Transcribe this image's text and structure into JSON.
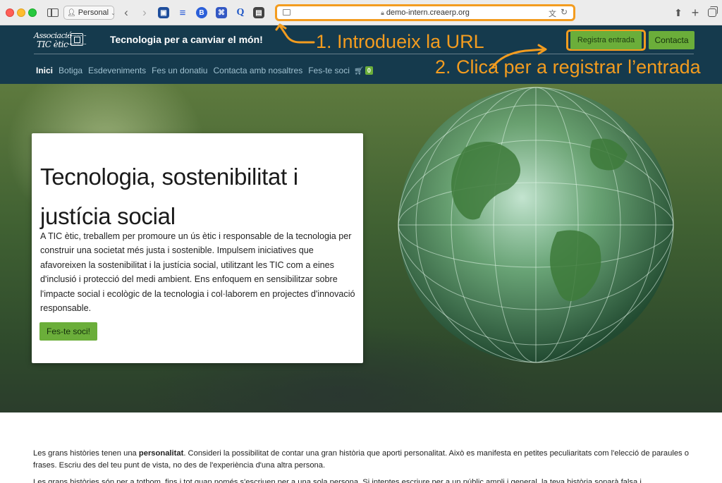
{
  "browser": {
    "profile_label": "Personal",
    "url": "demo-intern.creaerp.org",
    "extensions": [
      "bitwarden-icon",
      "layers-icon",
      "b-circle-icon",
      "translate-box-icon",
      "q-icon",
      "capture-icon"
    ]
  },
  "header": {
    "logo_line1": "Associació",
    "logo_line2": "TIC ètic",
    "tagline": "Tecnologia per a canviar el món!",
    "registra_label": "Registra entrada",
    "contacta_label": "Contacta",
    "accent_color": "#6bae3a",
    "bg_color": "#153a4d"
  },
  "nav": {
    "items": [
      "Inici",
      "Botiga",
      "Esdeveniments",
      "Fes un donatiu",
      "Contacta amb nosaltres",
      "Fes-te soci"
    ],
    "cart_count": "0"
  },
  "annotations": {
    "step1": "1. Introdueix la URL",
    "step2": "2. Clica per a registrar l’entrada",
    "color": "#f39c1f"
  },
  "hero": {
    "title": "Tecnologia, sostenibilitat i justícia social",
    "text": "A TIC ètic, treballem per promoure un ús ètic i responsable de la tecnologia per construir una societat més justa i sostenible. Impulsem iniciatives que afavoreixen la sostenibilitat i la justícia social, utilitzant les TIC com a eines d'inclusió i protecció del medi ambient. Ens enfoquem en sensibilitzar sobre l'impacte social i ecològic de la tecnologia i col·laborem en projectes d'innovació responsable.",
    "button_label": "Fes-te soci!"
  },
  "body": {
    "para1_before": "Les grans històries tenen una ",
    "para1_bold": "personalitat",
    "para1_after": ". Consideri la possibilitat de contar una gran història que aporti personalitat. Això es manifesta en petites peculiaritats com l'elecció de paraules o frases. Escriu des del teu punt de vista, no des de l'experiència d'una altra persona.",
    "para2": "Les grans històries són per a tothom, fins i tot quan només s'escriuen per a una sola persona. Si intentes escriure per a un públic ampli i general, la teva història sonarà falsa i"
  }
}
